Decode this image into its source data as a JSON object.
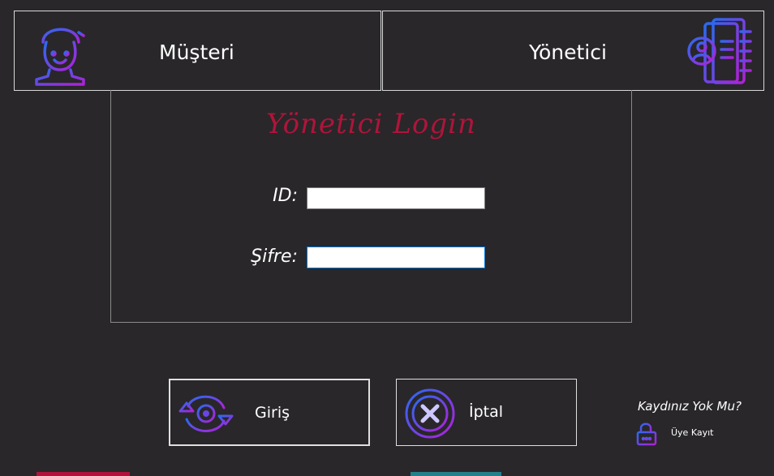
{
  "roles": {
    "customer_label": "Müşteri",
    "admin_label": "Yönetici"
  },
  "login": {
    "title": "Yönetici Login",
    "id_label": "ID:",
    "id_value": "",
    "password_label": "Şifre:",
    "password_value": ""
  },
  "actions": {
    "login_label": "Giriş",
    "cancel_label": "İptal"
  },
  "signup": {
    "question": "Kaydınız Yok Mu?",
    "link_label": "Üye Kayıt"
  },
  "colors": {
    "background": "#29272a",
    "title_red": "#b0143a",
    "icon_gradient_start": "#2a6bf0",
    "icon_gradient_end": "#b020d8"
  },
  "icons": {
    "customer": "customer-avatar-icon",
    "admin": "admin-contact-book-icon",
    "login": "refresh-target-icon",
    "cancel": "close-circle-icon",
    "signup": "lock-icon"
  }
}
